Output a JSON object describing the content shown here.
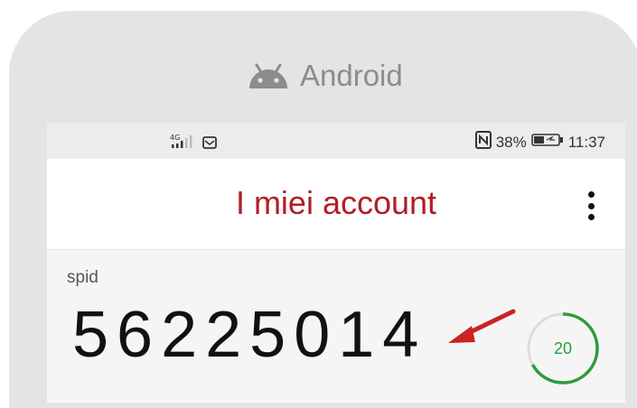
{
  "device": {
    "label": "Android",
    "icon": "android-robot-icon"
  },
  "status_bar": {
    "network": "4G",
    "battery_percent": "38%",
    "time": "11:37",
    "icons": [
      "signal-icon",
      "message-icon",
      "nfc-icon",
      "battery-icon"
    ]
  },
  "app_bar": {
    "title": "I miei account",
    "menu_icon": "more-vert-icon"
  },
  "account": {
    "name": "spid",
    "otp_code": "56225014",
    "timer_seconds": "20",
    "timer_fraction_remaining": 0.67
  },
  "colors": {
    "title": "#b01e24",
    "timer": "#2e9b3c",
    "arrow": "#cc2222",
    "device_frame": "#e4e4e4"
  }
}
